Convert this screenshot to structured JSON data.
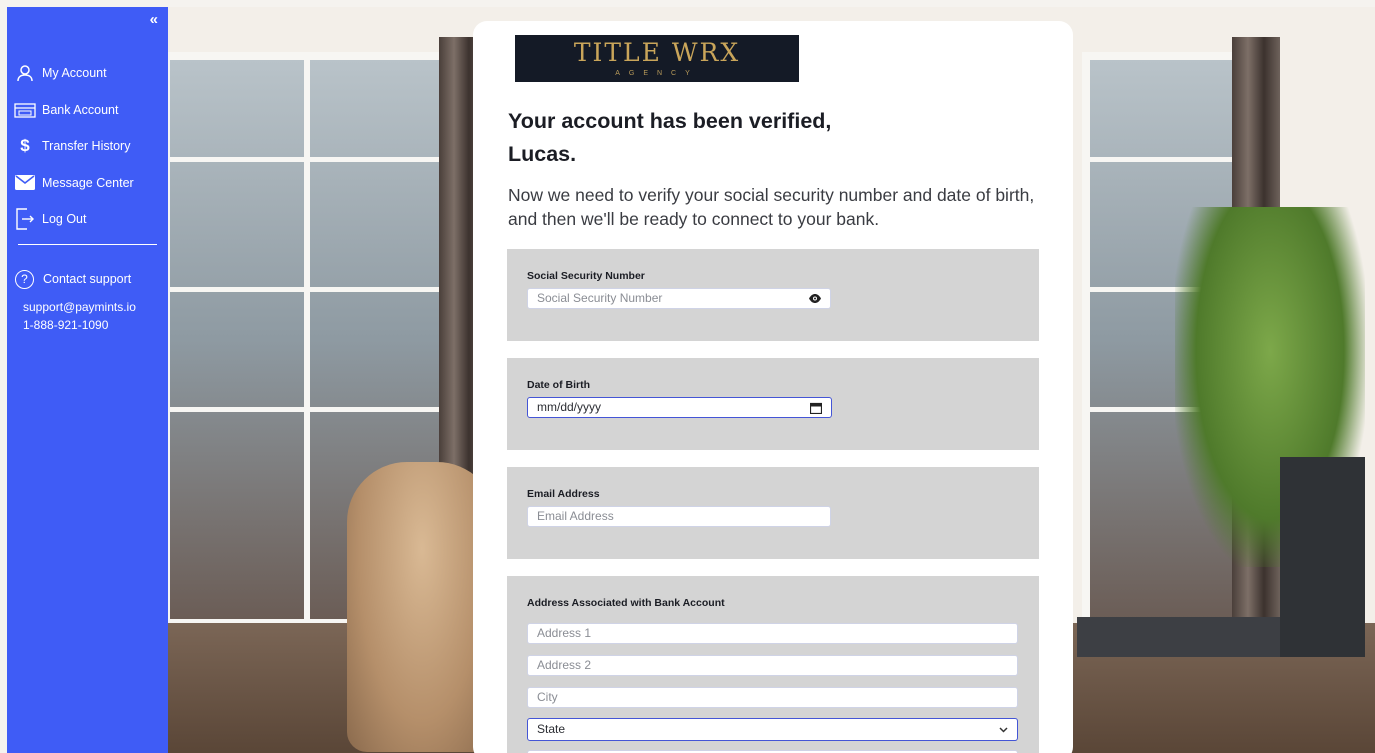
{
  "sidebar": {
    "collapse_label": "«",
    "items": [
      {
        "label": "My Account",
        "icon": "user-icon"
      },
      {
        "label": "Bank Account",
        "icon": "bank-icon"
      },
      {
        "label": "Transfer History",
        "icon": "dollar-icon"
      },
      {
        "label": "Message Center",
        "icon": "envelope-icon"
      },
      {
        "label": "Log Out",
        "icon": "logout-icon"
      }
    ],
    "support": {
      "title": "Contact support",
      "email": "support@paymints.io",
      "phone": "1-888-921-1090"
    },
    "accent_color": "#3f5cf6"
  },
  "card": {
    "logo": {
      "main": "TITLE WRX",
      "sub": "AGENCY"
    },
    "headline_line1": "Your account has been verified,",
    "headline_line2": "Lucas.",
    "subtext": "Now we need to verify your social security number and date of birth, and then we'll be ready to connect to your bank.",
    "ssn": {
      "label": "Social Security Number",
      "placeholder": "Social Security Number"
    },
    "dob": {
      "label": "Date of Birth",
      "value": "mm/dd/yyyy"
    },
    "email": {
      "label": "Email Address",
      "placeholder": "Email Address"
    },
    "address": {
      "label": "Address Associated with Bank Account",
      "address1_placeholder": "Address 1",
      "address2_placeholder": "Address 2",
      "city_placeholder": "City",
      "state_value": "State"
    }
  }
}
